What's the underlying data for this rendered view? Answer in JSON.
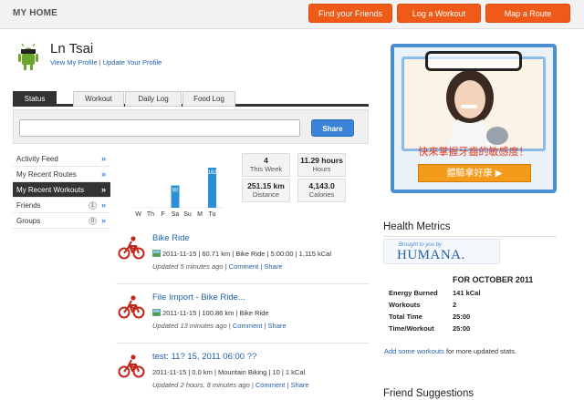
{
  "header": {
    "brand": "MY HOME",
    "buttons": [
      "Find your Friends",
      "Log a Workout",
      "Map a Route"
    ]
  },
  "profile": {
    "name": "Ln Tsai",
    "view_profile": "View My Profile",
    "separator": "|",
    "update_profile": "Update Your Profile"
  },
  "tabs": [
    {
      "label": "Status",
      "active": true
    },
    {
      "label": "Workout",
      "active": false
    },
    {
      "label": "Daily Log",
      "active": false
    },
    {
      "label": "Food Log",
      "active": false
    }
  ],
  "status": {
    "placeholder": "",
    "share_label": "Share"
  },
  "left_nav": [
    {
      "label": "Activity Feed",
      "arrow": "»",
      "badge": null,
      "active": false
    },
    {
      "label": "My Recent Routes",
      "arrow": "»",
      "badge": null,
      "active": false
    },
    {
      "label": "My Recent Workouts",
      "arrow": "»",
      "badge": null,
      "active": true
    },
    {
      "label": "Friends",
      "arrow": "»",
      "badge": "1",
      "active": false
    },
    {
      "label": "Groups",
      "arrow": "»",
      "badge": "0",
      "active": false
    }
  ],
  "chart_data": {
    "type": "bar",
    "categories": [
      "W",
      "Th",
      "F",
      "Sa",
      "Su",
      "M",
      "Tu"
    ],
    "values": [
      0,
      0,
      0,
      90,
      0,
      0,
      162
    ],
    "data_labels": [
      "",
      "",
      "",
      "90",
      "",
      "",
      "162"
    ],
    "bar_color": "#2a8fd4",
    "title": "",
    "xlabel": "",
    "ylabel": ""
  },
  "stats": {
    "workouts": {
      "value": "4",
      "label": "This Week"
    },
    "hours": {
      "value": "11.29 hours",
      "label": "Hours"
    },
    "distance": {
      "value": "251.15 km",
      "label": "Distance"
    },
    "calories": {
      "value": "4,143.0",
      "label": "Calories"
    }
  },
  "feed": [
    {
      "title": "Bike Ride",
      "detail": "2011-11-15 | 60.71 km | Bike Ride | 5:00:00 | 1,115 kCal",
      "meta": "Updated 5 minutes ago |",
      "comment": "Comment",
      "sep": "|",
      "share": "Share"
    },
    {
      "title": "File Import - Bike Ride...",
      "detail": "2011-11-15 | 100.86 km | Bike Ride",
      "meta": "Updated 13 minutes ago |",
      "comment": "Comment",
      "sep": "|",
      "share": "Share"
    },
    {
      "title": "test: 11? 15, 2011 06:00 ??",
      "detail": "2011-11-15 | 0.0 km | Mountain Biking | 10 | 1 kCal",
      "meta": "Updated 2 hours, 8 minutes ago |",
      "comment": "Comment",
      "sep": "|",
      "share": "Share"
    }
  ],
  "ad": {
    "headline": "快來掌握牙齒的敏感度！",
    "cta": "體驗拿好康 ▶"
  },
  "health": {
    "title": "Health Metrics",
    "sponsor_tag": "Brought to you by",
    "sponsor": "HUMANA.",
    "period": "FOR OCTOBER 2011",
    "rows": [
      {
        "label": "Energy Burned",
        "value": "141 kCal"
      },
      {
        "label": "Workouts",
        "value": "2"
      },
      {
        "label": "Total Time",
        "value": "25:00"
      },
      {
        "label": "Time/Workout",
        "value": "25:00"
      }
    ],
    "add_link": "Add some workouts",
    "add_suffix": "for more updated stats."
  },
  "friends": {
    "title": "Friend Suggestions"
  },
  "colors": {
    "accent_orange": "#f05a18",
    "link_blue": "#1f5fa8",
    "share_blue": "#3c82d6",
    "dark_tab": "#333333"
  }
}
